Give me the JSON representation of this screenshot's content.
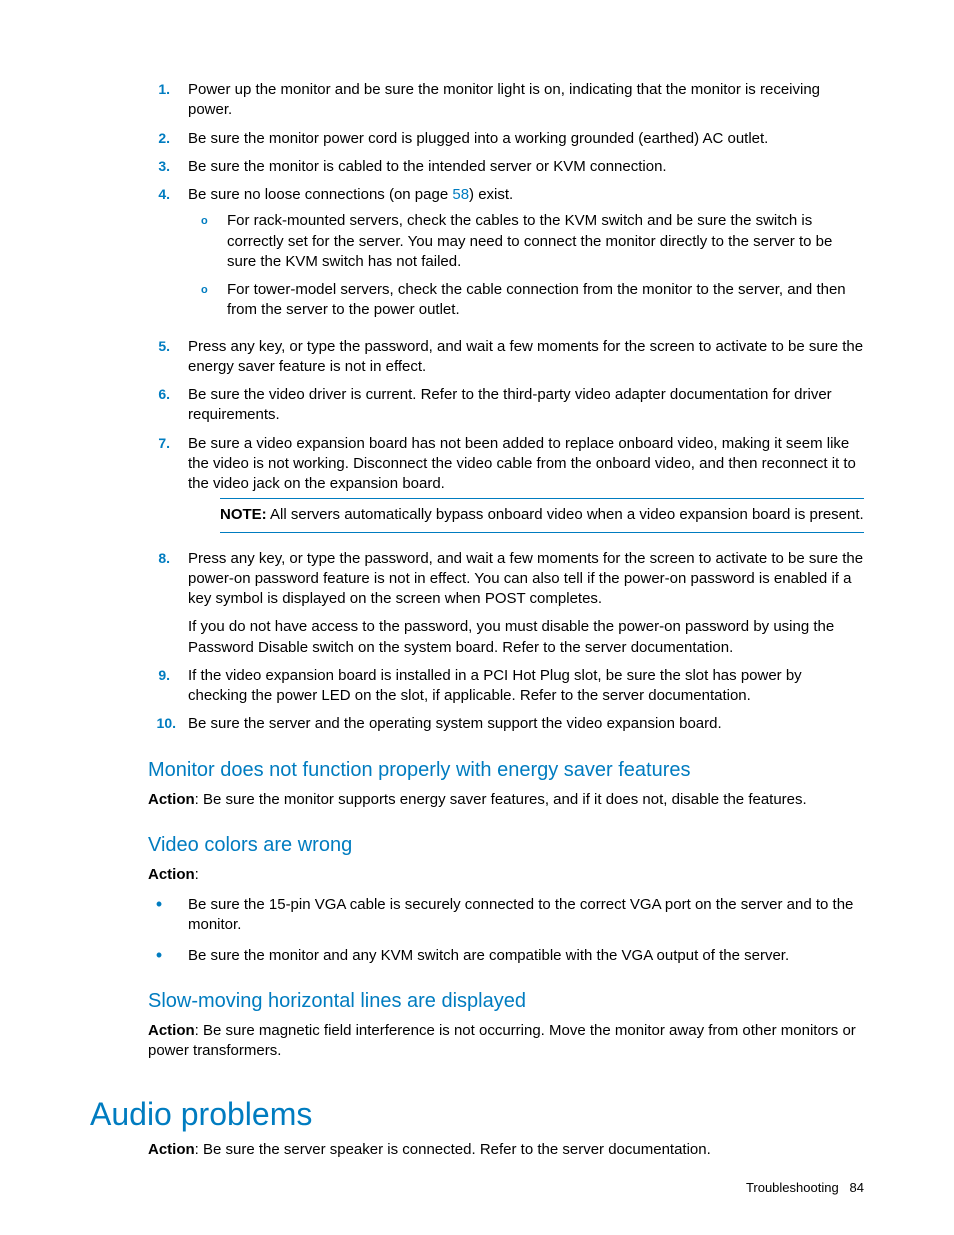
{
  "ol": [
    {
      "n": "1.",
      "body": "Power up the monitor and be sure the monitor light is on, indicating that the monitor is receiving power."
    },
    {
      "n": "2.",
      "body": "Be sure the monitor power cord is plugged into a working grounded (earthed) AC outlet."
    },
    {
      "n": "3.",
      "body": "Be sure the monitor is cabled to the intended server or KVM connection."
    },
    {
      "n": "4.",
      "body_pre": "Be sure no loose connections (on page ",
      "link": "58",
      "body_post": ") exist.",
      "subs": [
        "For rack-mounted servers, check the cables to the KVM switch and be sure the switch is correctly set for the server. You may need to connect the monitor directly to the server to be sure the KVM switch has not failed.",
        "For tower-model servers, check the cable connection from the monitor to the server, and then from the server to the power outlet."
      ]
    },
    {
      "n": "5.",
      "body": "Press any key, or type the password, and wait a few moments for the screen to activate to be sure the energy saver feature is not in effect."
    },
    {
      "n": "6.",
      "body": "Be sure the video driver is current. Refer to the third-party video adapter documentation for driver requirements."
    },
    {
      "n": "7.",
      "body": "Be sure a video expansion board has not been added to replace onboard video, making it seem like the video is not working. Disconnect the video cable from the onboard video, and then reconnect it to the video jack on the expansion board.",
      "note_label": "NOTE:",
      "note_body": "  All servers automatically bypass onboard video when a video expansion board is present."
    },
    {
      "n": "8.",
      "body": "Press any key, or type the password, and wait a few moments for the screen to activate to be sure the power-on password feature is not in effect. You can also tell if the power-on password is enabled if a key symbol is displayed on the screen when POST completes.",
      "para2": "If you do not have access to the password, you must disable the power-on password by using the Password Disable switch on the system board. Refer to the server documentation."
    },
    {
      "n": "9.",
      "body": "If the video expansion board is installed in a PCI Hot Plug slot, be sure the slot has power by checking the power LED on the slot, if applicable. Refer to the server documentation."
    },
    {
      "n": "10.",
      "body": "Be sure the server and the operating system support the video expansion board."
    }
  ],
  "sec1": {
    "title": "Monitor does not function properly with energy saver features",
    "action_label": "Action",
    "action_body": ": Be sure the monitor supports energy saver features, and if it does not, disable the features."
  },
  "sec2": {
    "title": "Video colors are wrong",
    "action_label": "Action",
    "action_colon": ":",
    "bullets": [
      "Be sure the 15-pin VGA cable is securely connected to the correct VGA port on the server and to the monitor.",
      "Be sure the monitor and any KVM switch are compatible with the VGA output of the server."
    ]
  },
  "sec3": {
    "title": "Slow-moving horizontal lines are displayed",
    "action_label": "Action",
    "action_body": ": Be sure magnetic field interference is not occurring. Move the monitor away from other monitors or power transformers."
  },
  "audio": {
    "title": "Audio problems",
    "action_label": "Action",
    "action_body": ": Be sure the server speaker is connected. Refer to the server documentation."
  },
  "footer": {
    "section": "Troubleshooting",
    "page": "84"
  }
}
